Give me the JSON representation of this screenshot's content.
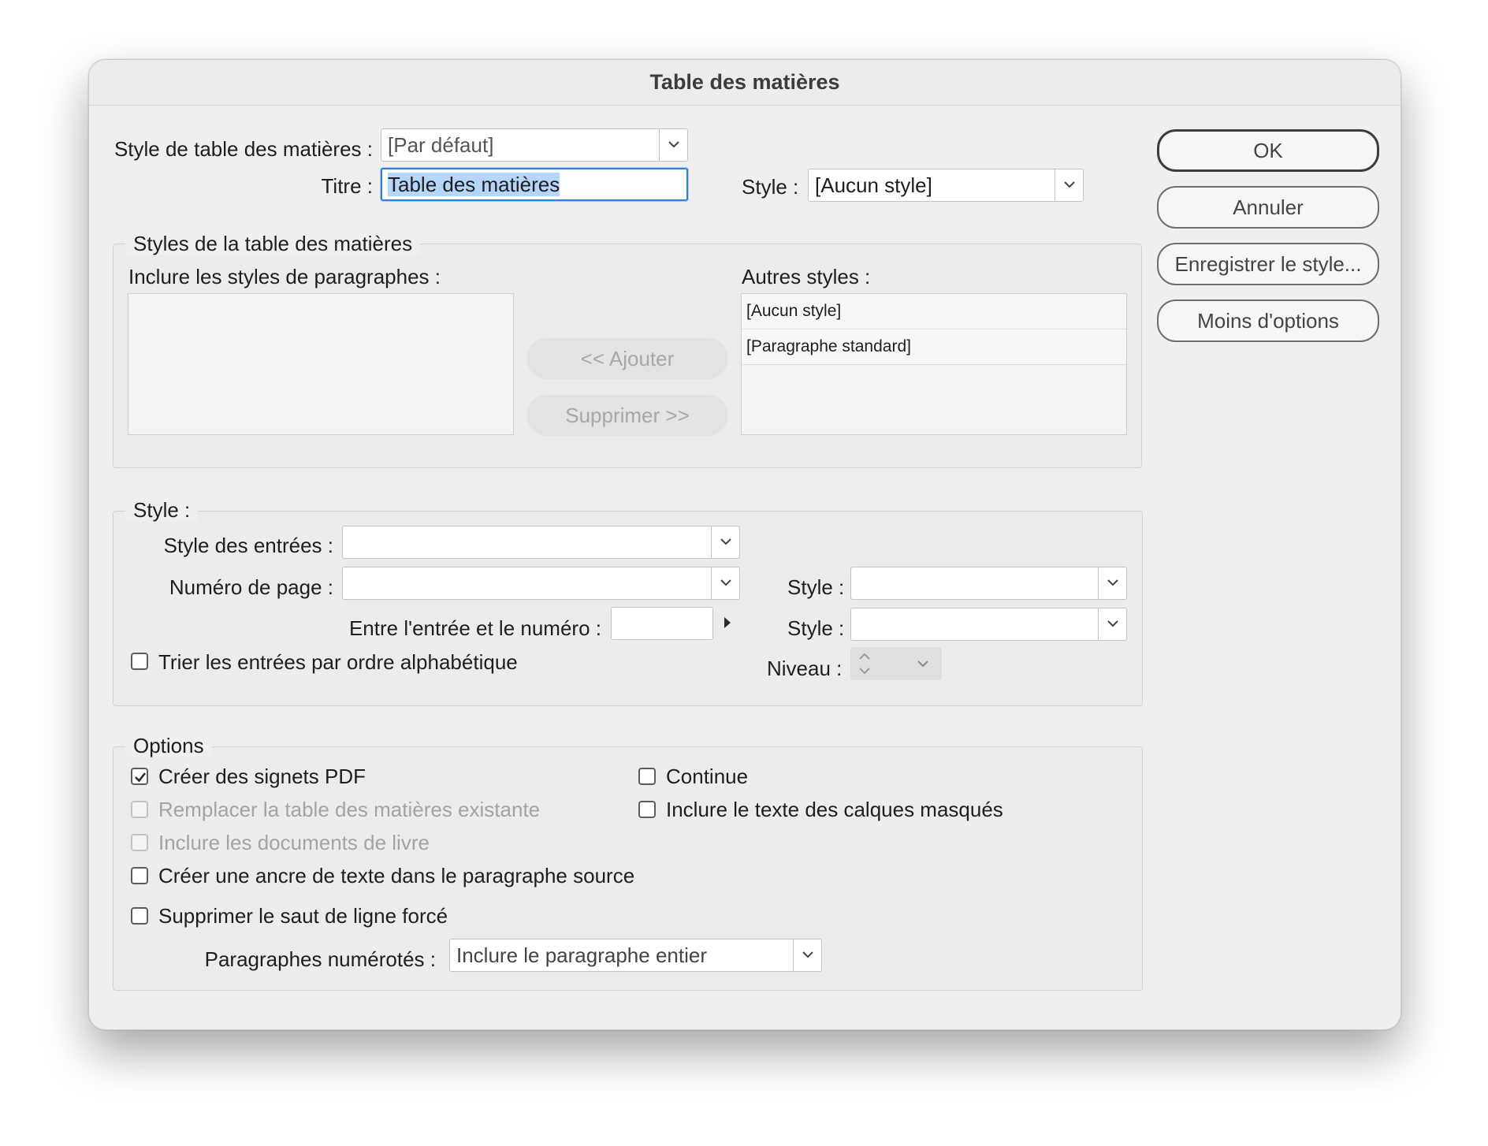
{
  "window": {
    "title": "Table des matières"
  },
  "top": {
    "toc_style_label": "Style de table des matières :",
    "toc_style_value": "[Par défaut]",
    "title_label": "Titre :",
    "title_value": "Table des matières",
    "title_style_label": "Style :",
    "title_style_value": "[Aucun style]"
  },
  "styles_section": {
    "legend": "Styles de la table des matières",
    "include_label": "Inclure les styles de paragraphes :",
    "other_label": "Autres styles :",
    "other_items": [
      "[Aucun style]",
      "[Paragraphe standard]"
    ],
    "add_button": "<< Ajouter",
    "remove_button": "Supprimer >>"
  },
  "style_section": {
    "legend": "Style :",
    "entry_style_label": "Style des entrées :",
    "page_number_label": "Numéro de page :",
    "page_number_style_label": "Style :",
    "between_label": "Entre l'entrée et le numéro :",
    "between_style_label": "Style :",
    "sort_label": "Trier les entrées par ordre alphabétique",
    "level_label": "Niveau :"
  },
  "options_section": {
    "legend": "Options",
    "create_pdf_bookmarks": {
      "label": "Créer des signets PDF",
      "checked": true
    },
    "replace_existing": {
      "label": "Remplacer la table des matières existante",
      "checked": false
    },
    "include_book_docs": {
      "label": "Inclure les documents de livre",
      "checked": false
    },
    "create_text_anchor": {
      "label": "Créer une ancre de texte dans le paragraphe source",
      "checked": false
    },
    "remove_forced_break": {
      "label": "Supprimer le saut de ligne forcé",
      "checked": false
    },
    "run_in": {
      "label": "Continue",
      "checked": false
    },
    "include_hidden_layers": {
      "label": "Inclure le texte des calques masqués",
      "checked": false
    },
    "numbered_paragraphs_label": "Paragraphes numérotés :",
    "numbered_paragraphs_value": "Inclure le paragraphe entier"
  },
  "buttons": {
    "ok": "OK",
    "cancel": "Annuler",
    "save_style": "Enregistrer le style...",
    "fewer_options": "Moins d'options"
  }
}
